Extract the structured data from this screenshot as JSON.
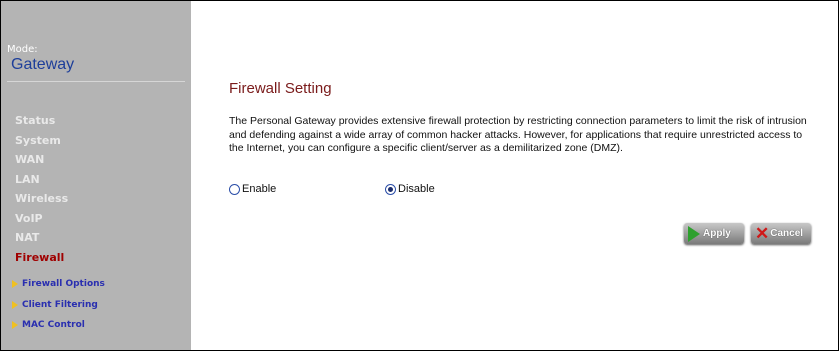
{
  "sidebar": {
    "mode_label": "Mode:",
    "mode_value": "Gateway",
    "nav": [
      "Status",
      "System",
      "WAN",
      "LAN",
      "Wireless",
      "VoIP",
      "NAT",
      "Firewall"
    ],
    "active": "Firewall",
    "submenu": [
      "Firewall Options",
      "Client Filtering",
      "MAC Control"
    ]
  },
  "main": {
    "title": "Firewall Setting",
    "description": "The Personal Gateway provides extensive firewall protection by restricting connection parameters to limit the risk of intrusion and defending against a wide array of common hacker attacks. However, for applications that require unrestricted access to the Internet, you can configure a specific client/server as a demilitarized zone (DMZ).",
    "options": {
      "enable": "Enable",
      "disable": "Disable",
      "selected": "Disable"
    },
    "buttons": {
      "apply": "Apply",
      "cancel": "Cancel"
    }
  },
  "colors": {
    "sidebar_bg": "#b4b4b4",
    "active_nav": "#a00000",
    "title": "#7a1b1b",
    "submenu": "#2a2fb0"
  }
}
